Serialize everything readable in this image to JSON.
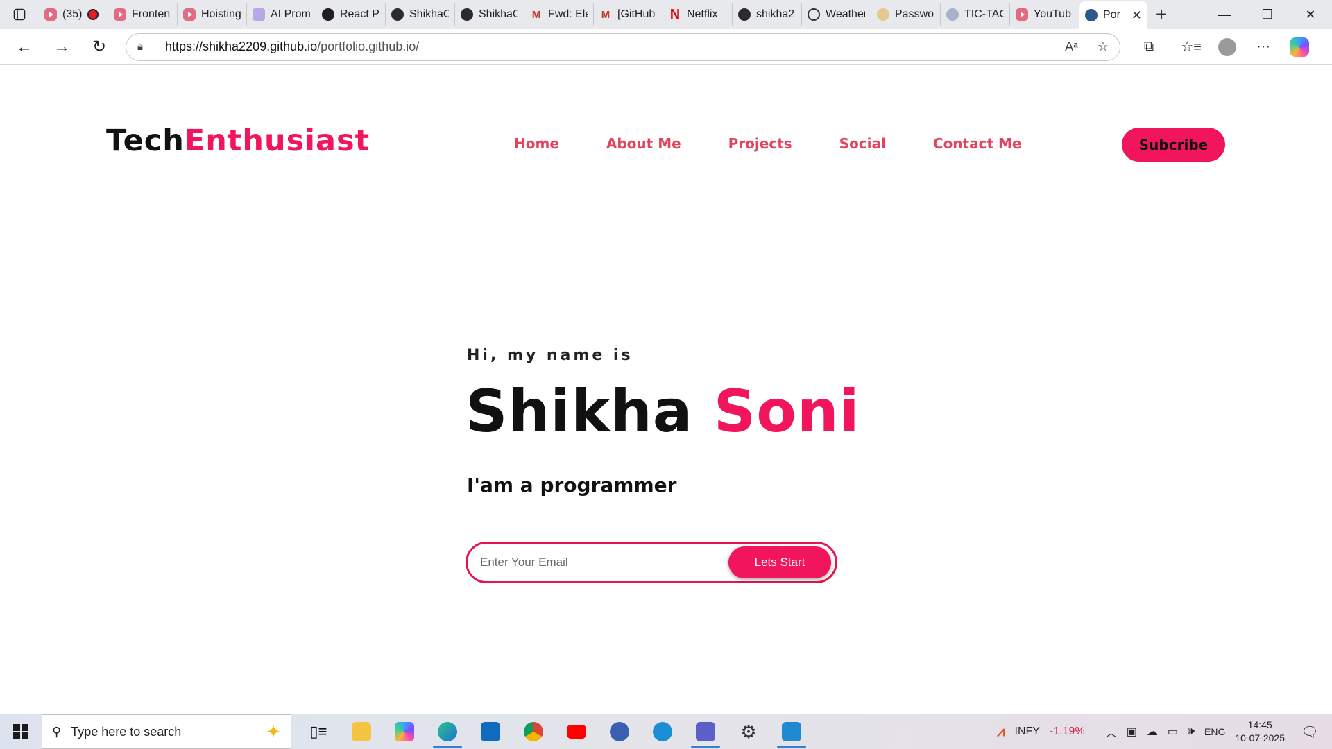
{
  "browser": {
    "tabs": [
      {
        "label": "(35)",
        "icon": "youtube-icon",
        "recording": true
      },
      {
        "label": "Fronten",
        "icon": "youtube-icon"
      },
      {
        "label": "Hoisting",
        "icon": "youtube-icon"
      },
      {
        "label": "AI Prom",
        "icon": "ai-icon"
      },
      {
        "label": "React Pr",
        "icon": "openai-icon"
      },
      {
        "label": "ShikhaC",
        "icon": "github-icon"
      },
      {
        "label": "ShikhaC",
        "icon": "github-icon"
      },
      {
        "label": "Fwd: Ele",
        "icon": "gmail-icon"
      },
      {
        "label": "[GitHub",
        "icon": "gmail-icon"
      },
      {
        "label": "Netflix",
        "icon": "netflix-icon"
      },
      {
        "label": "shikha2",
        "icon": "github-icon"
      },
      {
        "label": "Weather",
        "icon": "globe-icon"
      },
      {
        "label": "Passwor",
        "icon": "password-icon"
      },
      {
        "label": "TIC-TAC",
        "icon": "tictactoe-icon"
      },
      {
        "label": "YouTub",
        "icon": "youtube-icon"
      },
      {
        "label": "Por",
        "icon": "portfolio-icon",
        "active": true
      }
    ],
    "url_host": "https://shikha2209.github.io",
    "url_path": "/portfolio.github.io/"
  },
  "site": {
    "logo_main": "Tech",
    "logo_accent": "Enthusiast",
    "nav": [
      "Home",
      "About Me",
      "Projects",
      "Social",
      "Contact Me"
    ],
    "subscribe_label": "Subcribe",
    "greeting": "Hi, my name is",
    "first_name": "Shikha",
    "last_name": "Soni",
    "role": "I'am a programmer",
    "email_placeholder": "Enter Your Email",
    "cta_label": "Lets Start",
    "colors": {
      "accent": "#f1155b",
      "nav": "#e0445f"
    }
  },
  "taskbar": {
    "search_placeholder": "Type here to search",
    "stock_symbol": "INFY",
    "stock_change": "-1.19%",
    "language": "ENG",
    "time": "14:45",
    "date": "10-07-2025"
  }
}
